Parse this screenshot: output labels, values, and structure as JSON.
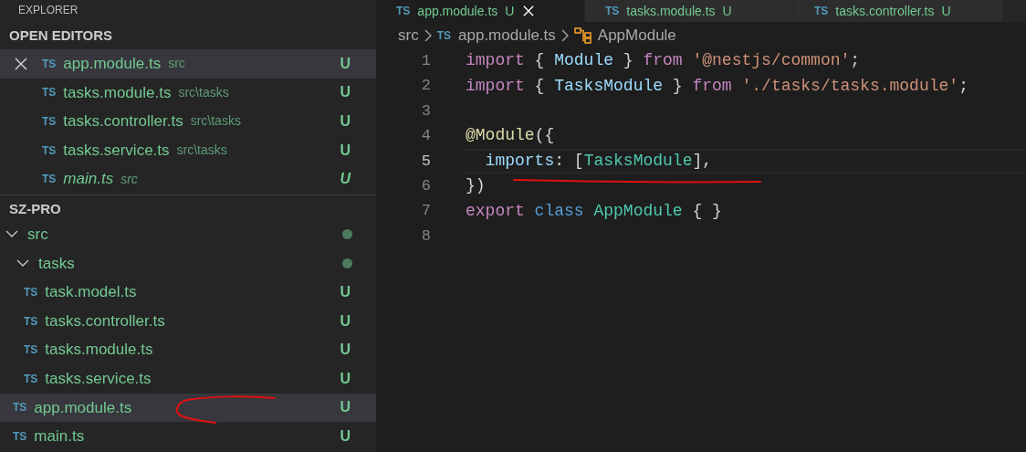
{
  "explorer": {
    "title": "EXPLORER"
  },
  "open_editors": {
    "title": "OPEN EDITORS",
    "items": [
      {
        "icon": "TS",
        "name": "app.module.ts",
        "path": "src",
        "status": "U",
        "selected": true,
        "preview": false
      },
      {
        "icon": "TS",
        "name": "tasks.module.ts",
        "path": "src\\tasks",
        "status": "U",
        "selected": false,
        "preview": false
      },
      {
        "icon": "TS",
        "name": "tasks.controller.ts",
        "path": "src\\tasks",
        "status": "U",
        "selected": false,
        "preview": false
      },
      {
        "icon": "TS",
        "name": "tasks.service.ts",
        "path": "src\\tasks",
        "status": "U",
        "selected": false,
        "preview": false
      },
      {
        "icon": "TS",
        "name": "main.ts",
        "path": "src",
        "status": "U",
        "selected": false,
        "preview": true
      }
    ]
  },
  "folder": {
    "title": "SZ-PRO",
    "tree": [
      {
        "kind": "folder",
        "name": "src",
        "expanded": true,
        "has_changes": true,
        "children": [
          {
            "kind": "folder",
            "name": "tasks",
            "expanded": true,
            "has_changes": true,
            "children": [
              {
                "kind": "file",
                "icon": "TS",
                "name": "task.model.ts",
                "status": "U",
                "selected": false
              },
              {
                "kind": "file",
                "icon": "TS",
                "name": "tasks.controller.ts",
                "status": "U",
                "selected": false
              },
              {
                "kind": "file",
                "icon": "TS",
                "name": "tasks.module.ts",
                "status": "U",
                "selected": false
              },
              {
                "kind": "file",
                "icon": "TS",
                "name": "tasks.service.ts",
                "status": "U",
                "selected": false
              }
            ]
          },
          {
            "kind": "file",
            "icon": "TS",
            "name": "app.module.ts",
            "status": "U",
            "selected": true
          },
          {
            "kind": "file",
            "icon": "TS",
            "name": "main.ts",
            "status": "U",
            "selected": false
          }
        ]
      }
    ]
  },
  "tabs": [
    {
      "icon": "TS",
      "label": "app.module.ts",
      "status": "U",
      "selected": true
    },
    {
      "icon": "TS",
      "label": "tasks.module.ts",
      "status": "U",
      "selected": false
    },
    {
      "icon": "TS",
      "label": "tasks.controller.ts",
      "status": "U",
      "selected": false
    }
  ],
  "breadcrumb": [
    {
      "kind": "folder",
      "text": "src"
    },
    {
      "kind": "file",
      "icon": "TS",
      "text": "app.module.ts"
    },
    {
      "kind": "class",
      "text": "AppModule"
    }
  ],
  "code": [
    {
      "number": "1",
      "current": false,
      "tokens": [
        {
          "kind": "keyword",
          "text": "import"
        },
        {
          "kind": "punct",
          "text": " { "
        },
        {
          "kind": "variable",
          "text": "Module"
        },
        {
          "kind": "punct",
          "text": " } "
        },
        {
          "kind": "keyword",
          "text": "from"
        },
        {
          "kind": "string",
          "text": " '@nestjs/common'"
        },
        {
          "kind": "punct",
          "text": ";"
        }
      ]
    },
    {
      "number": "2",
      "current": false,
      "tokens": [
        {
          "kind": "keyword",
          "text": "import"
        },
        {
          "kind": "punct",
          "text": " { "
        },
        {
          "kind": "variable",
          "text": "TasksModule"
        },
        {
          "kind": "punct",
          "text": " } "
        },
        {
          "kind": "keyword",
          "text": "from"
        },
        {
          "kind": "string",
          "text": " './tasks/tasks.module'"
        },
        {
          "kind": "punct",
          "text": ";"
        }
      ]
    },
    {
      "number": "3",
      "current": false
    },
    {
      "number": "4",
      "current": false,
      "tokens": [
        {
          "kind": "decorator",
          "text": "@Module"
        },
        {
          "kind": "punct",
          "text": "({"
        }
      ]
    },
    {
      "number": "5",
      "current": true,
      "tokens": [
        {
          "kind": "variable",
          "text": "  imports"
        },
        {
          "kind": "punct",
          "text": ": ["
        },
        {
          "kind": "class",
          "text": "TasksModule"
        },
        {
          "kind": "punct",
          "text": "],"
        }
      ]
    },
    {
      "number": "6",
      "current": false,
      "tokens": [
        {
          "kind": "punct",
          "text": "})"
        }
      ]
    },
    {
      "number": "7",
      "current": false,
      "tokens": [
        {
          "kind": "keyword",
          "text": "export"
        },
        {
          "kind": "storage",
          "text": " class"
        },
        {
          "kind": "class",
          "text": " AppModule"
        },
        {
          "kind": "punct",
          "text": " { }"
        }
      ]
    },
    {
      "number": "8",
      "current": false
    }
  ]
}
